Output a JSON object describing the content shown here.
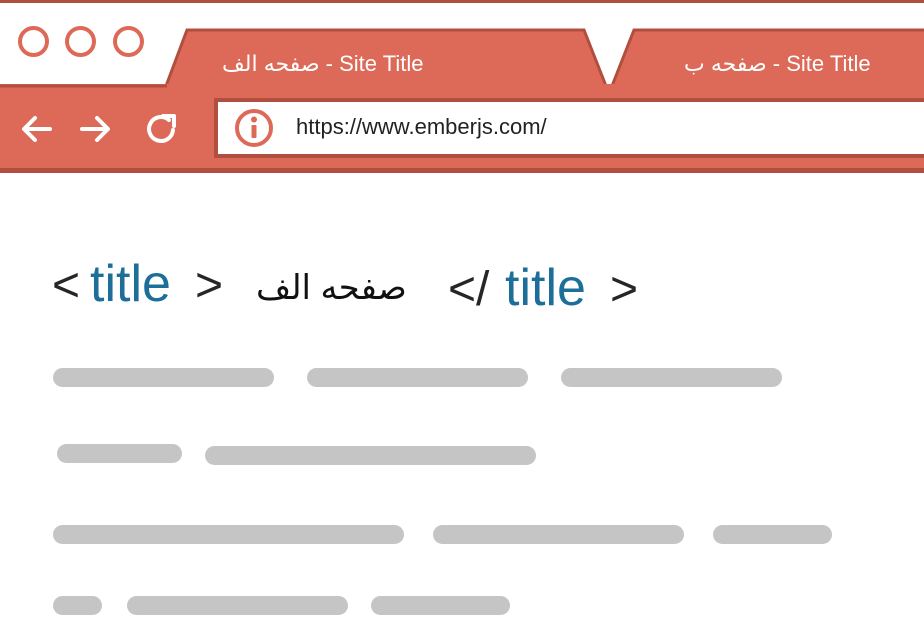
{
  "colors": {
    "browser_accent": "#dd6a58",
    "browser_shadow": "#b14f3f",
    "placeholder": "#c5c5c5",
    "tag_blue": "#1e6e9a",
    "text_dark": "#262626"
  },
  "window_controls": {
    "close": "circle-icon",
    "minimize": "circle-icon",
    "maximize": "circle-icon"
  },
  "tabs": [
    {
      "label": "صفحه الف - Site Title",
      "active": true
    },
    {
      "label": "صفحه ب - Site Title",
      "active": false
    }
  ],
  "toolbar": {
    "back_icon": "arrow-left-icon",
    "forward_icon": "arrow-right-icon",
    "reload_icon": "reload-icon",
    "info_icon": "info-icon",
    "url": "https://www.emberjs.com/"
  },
  "content": {
    "code_line": {
      "open_lt": "<",
      "open_tag": "title",
      "open_gt": ">",
      "text": "صفحه الف",
      "close_lt": "</",
      "close_tag": "title",
      "close_gt": ">"
    },
    "placeholder_text_lines": 4
  }
}
